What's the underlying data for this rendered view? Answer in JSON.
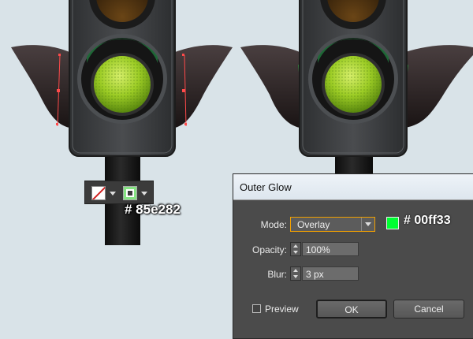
{
  "canvas": {
    "swatch_hex": "# 85e282",
    "swatch_color": "#85e282",
    "glow_color": "#00ff33"
  },
  "dialog": {
    "title": "Outer Glow",
    "mode_label": "Mode:",
    "mode_value": "Overlay",
    "color_hex": "# 00ff33",
    "opacity_label": "Opacity:",
    "opacity_value": "100%",
    "blur_label": "Blur:",
    "blur_value": "3 px",
    "preview_label": "Preview",
    "preview_checked": false,
    "ok_label": "OK",
    "cancel_label": "Cancel"
  },
  "icons": {
    "fill_swatch": "none-fill-swatch-icon",
    "stroke_swatch": "stroke-swatch-icon",
    "dropdown": "chevron-down-icon",
    "stepper": "stepper-arrows-icon"
  }
}
